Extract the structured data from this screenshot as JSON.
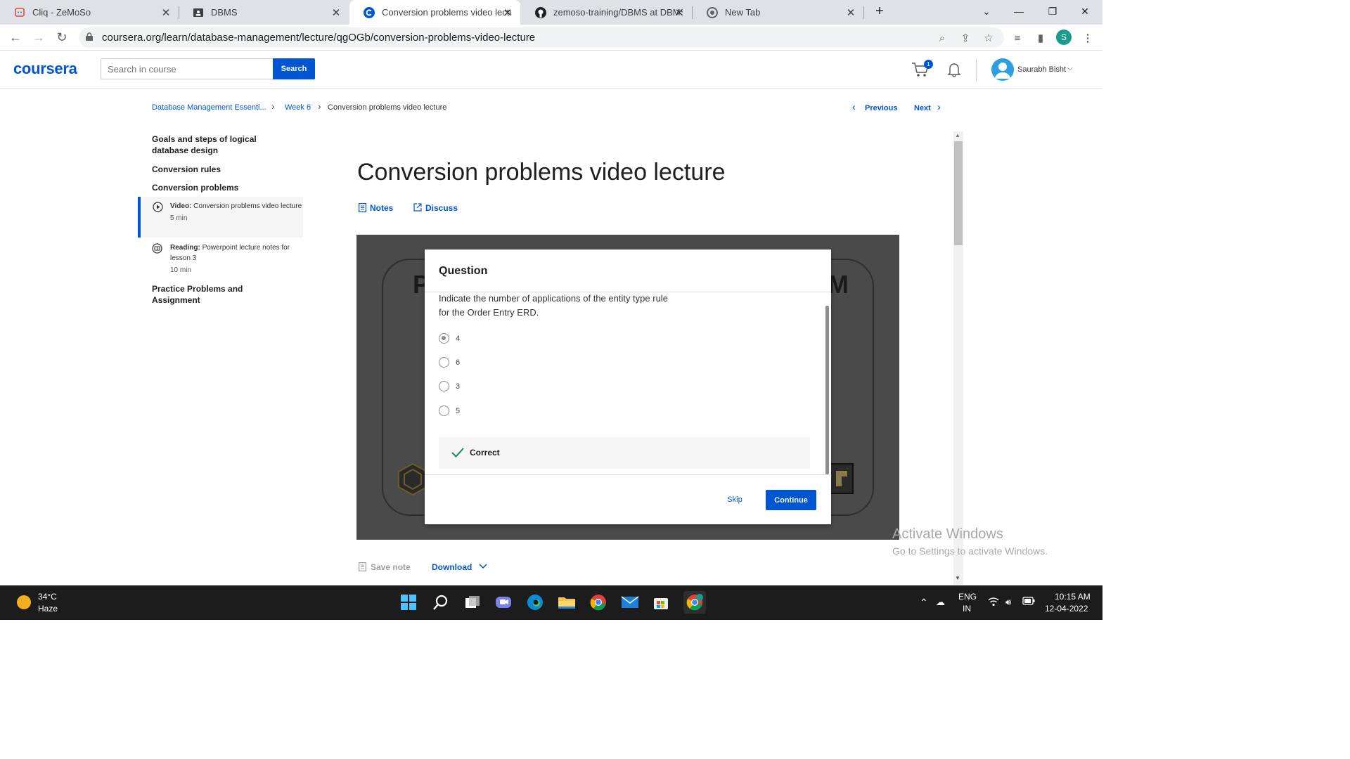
{
  "browser": {
    "tabs": [
      {
        "title": "Cliq - ZeMoSo",
        "icon": "cliq-icon"
      },
      {
        "title": "DBMS",
        "icon": "contact-card-icon"
      },
      {
        "title": "Conversion problems video lectu",
        "icon": "coursera-icon",
        "active": true
      },
      {
        "title": "zemoso-training/DBMS at DBMS",
        "icon": "github-icon"
      },
      {
        "title": "New Tab",
        "icon": "chrome-icon"
      }
    ],
    "url": "coursera.org/learn/database-management/lecture/qgOGb/conversion-problems-video-lecture",
    "profile_initial": "S"
  },
  "header": {
    "logo": "coursera",
    "search_placeholder": "Search in course",
    "search_label": "Search",
    "cart_count": "1",
    "user_name": "Saurabh Bisht"
  },
  "breadcrumb": {
    "course": "Database Management Essenti...",
    "week": "Week 6",
    "current": "Conversion problems video lecture"
  },
  "pager": {
    "previous": "Previous",
    "next": "Next"
  },
  "sidebar": {
    "sections": [
      {
        "label": "Goals and steps of logical database design"
      },
      {
        "label": "Conversion rules"
      },
      {
        "label": "Conversion problems"
      },
      {
        "label": "Practice Problems and Assignment"
      }
    ],
    "items": [
      {
        "type": "Video:",
        "title": "Conversion problems video lecture",
        "duration": "5 min",
        "active": true
      },
      {
        "type": "Reading:",
        "title": "Powerpoint lecture notes for lesson 3",
        "duration": "10 min",
        "active": false
      }
    ]
  },
  "main": {
    "title": "Conversion problems video lecture",
    "notes_label": "Notes",
    "discuss_label": "Discuss",
    "save_note_label": "Save note",
    "download_label": "Download"
  },
  "video": {
    "slide_left_letter": "P",
    "slide_right_letter": "M"
  },
  "quiz": {
    "heading": "Question",
    "question": "Indicate the number of applications of the entity type rule for the Order Entry ERD.",
    "options": [
      "4",
      "6",
      "3",
      "5"
    ],
    "selected_index": 0,
    "feedback": "Correct",
    "skip_label": "Skip",
    "continue_label": "Continue"
  },
  "watermark": {
    "line1": "Activate Windows",
    "line2": "Go to Settings to activate Windows."
  },
  "taskbar": {
    "temperature": "34°C",
    "condition": "Haze",
    "lang1": "ENG",
    "lang2": "IN",
    "time": "10:15 AM",
    "date": "12-04-2022"
  },
  "colors": {
    "brand": "#0056d2",
    "tab_strip": "#dee1e6",
    "taskbar": "#1c1c1c"
  }
}
